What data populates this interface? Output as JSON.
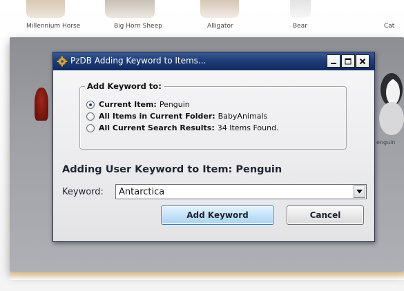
{
  "background": {
    "thumbnails": [
      {
        "label": "Millennium Horse"
      },
      {
        "label": "Big Horn Sheep"
      },
      {
        "label": "Alligator"
      },
      {
        "label": "Bear"
      },
      {
        "label": "Cat"
      }
    ],
    "side_label_right": "enguin"
  },
  "dialog": {
    "title": "PzDB Adding Keyword to Items...",
    "icons": {
      "app": "gear-icon",
      "minimize": "minimize-icon",
      "maximize": "maximize-icon",
      "close": "close-icon"
    },
    "group_title": "Add Keyword to:",
    "options": [
      {
        "label": "Current Item:",
        "value": "Penguin",
        "selected": true
      },
      {
        "label": "All Items in Current Folder:",
        "value": "BabyAnimals",
        "selected": false
      },
      {
        "label": "All Current Search Results:",
        "value": "34 Items Found.",
        "selected": false
      }
    ],
    "heading": "Adding User Keyword to Item: Penguin",
    "keyword_label": "Keyword:",
    "keyword_value": "Antarctica",
    "add_button": "Add Keyword",
    "cancel_button": "Cancel"
  },
  "colors": {
    "titlebar": "#1e3d78",
    "primary_button": "#c6e3f9",
    "backdrop": "#9ea0a6"
  }
}
